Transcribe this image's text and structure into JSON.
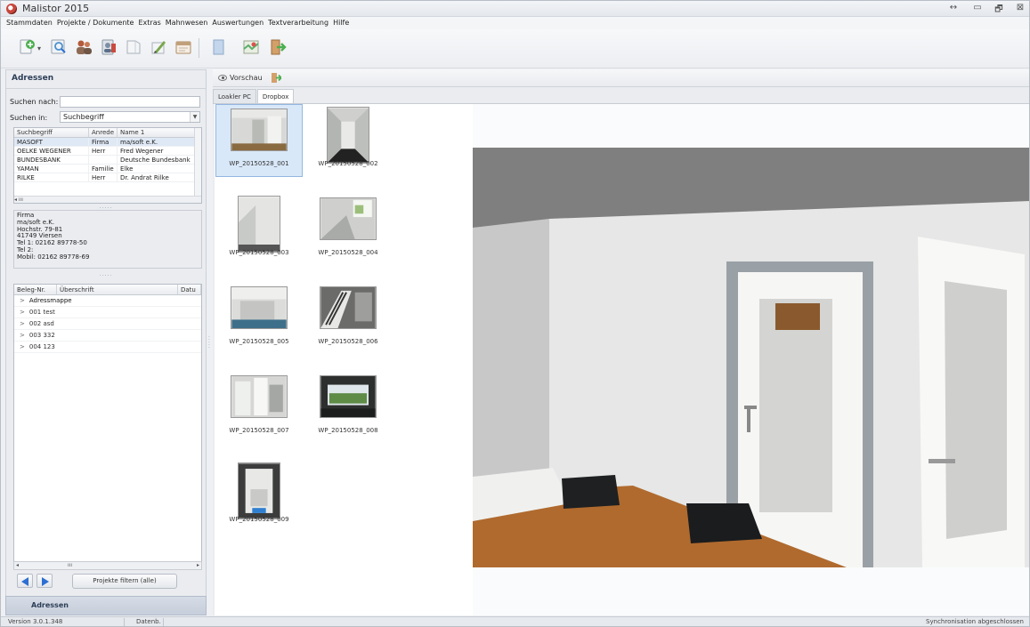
{
  "window": {
    "title": "Malistor 2015",
    "controls": [
      "↔",
      "▭",
      "🗗",
      "⊠"
    ]
  },
  "menu": [
    "Stammdaten",
    "Projekte / Dokumente",
    "Extras",
    "Mahnwesen",
    "Auswertungen",
    "Textverarbeitung",
    "Hilfe"
  ],
  "toolbar": {
    "buttons": [
      {
        "name": "new-address-icon",
        "color": "#4caf50"
      },
      {
        "name": "search-address-icon",
        "color": "#4a8fcc"
      },
      {
        "name": "contacts-icon",
        "color": "#b35b3a"
      },
      {
        "name": "user-group-icon",
        "color": "#7b8fa8"
      },
      {
        "name": "book-icon",
        "color": "#d7dde4"
      },
      {
        "name": "edit-document-icon",
        "color": "#7aa64b"
      },
      {
        "name": "calendar-icon",
        "color": "#c0a07a"
      },
      {
        "name": "document-icon",
        "color": "#c3d6ec"
      },
      {
        "name": "map-icon",
        "color": "#5cae6a"
      },
      {
        "name": "exit-icon",
        "color": "#e0843a"
      }
    ]
  },
  "left": {
    "title": "Adressen",
    "search_label": "Suchen nach:",
    "search_value": "",
    "search_in_label": "Suchen in:",
    "search_in_value": "Suchbegriff",
    "grid": {
      "columns": [
        "Suchbegriff",
        "Anrede",
        "Name 1"
      ],
      "rows": [
        {
          "key": "MASOFT",
          "salutation": "Firma",
          "name": "ma/soft e.K."
        },
        {
          "key": "OELKE WEGENER",
          "salutation": "Herr",
          "name": "Fred Wegener"
        },
        {
          "key": "BUNDESBANK",
          "salutation": "",
          "name": "Deutsche Bundesbank"
        },
        {
          "key": "YAMAN",
          "salutation": "Familie",
          "name": "Elke"
        },
        {
          "key": "RILKE",
          "salutation": "Herr",
          "name": "Dr. Andrat Rilke"
        }
      ],
      "hscroll_glyph": "◂ ııı"
    },
    "address": {
      "lines": [
        "Firma",
        "ma/soft e.K.",
        "Hochstr. 79-81",
        "41749 Viersen",
        "Tel 1: 02162 89778-50",
        "Tel 2:",
        "Mobil: 02162 89778-69"
      ]
    },
    "tree": {
      "columns": [
        "Beleg-Nr.",
        "Überschrift",
        "Datu"
      ],
      "rows": [
        "Adressmappe",
        "001 test",
        "002 asd",
        "003 332",
        "004 123"
      ]
    },
    "hscroll_glyph": "ııı",
    "filter_button": "Projekte filtern (alle)",
    "nav_tab": "Adressen",
    "splitter_glyph": "....."
  },
  "right": {
    "preview_label": "Vorschau",
    "tabs": [
      "Loakler PC",
      "Dropbox"
    ],
    "active_tab": 1,
    "thumbnails": [
      {
        "label": "WP_20150528_001",
        "selected": true
      },
      {
        "label": "WP_20150528_002",
        "selected": false
      },
      {
        "label": "WP_20150528_003",
        "selected": false
      },
      {
        "label": "WP_20150528_004",
        "selected": false
      },
      {
        "label": "WP_20150528_005",
        "selected": false
      },
      {
        "label": "WP_20150528_006",
        "selected": false
      },
      {
        "label": "WP_20150528_007",
        "selected": false
      },
      {
        "label": "WP_20150528_008",
        "selected": false
      },
      {
        "label": "WP_20150528_009",
        "selected": false
      }
    ]
  },
  "status": {
    "version": "Version 3.0.1.348",
    "db": "Datenb.",
    "sync": "Synchronisation abgeschlossen"
  },
  "colors": {
    "accent": "#2c6fd1",
    "panel": "#eaecf0",
    "selection": "#d9e8f8"
  }
}
